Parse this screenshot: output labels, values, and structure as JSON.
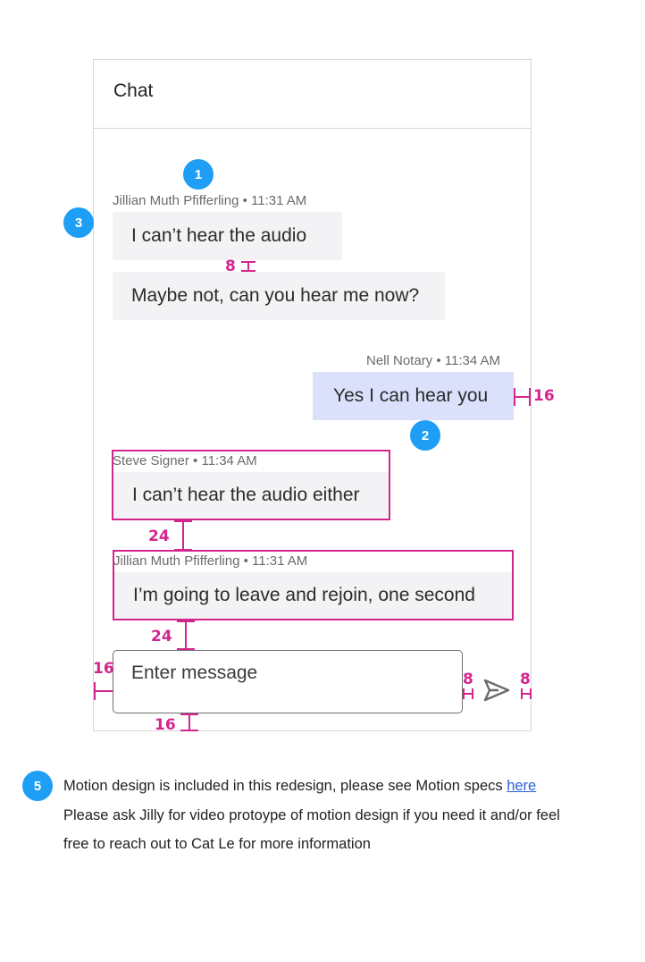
{
  "panel": {
    "title": "Chat"
  },
  "messages": [
    {
      "meta": "Jillian Muth Pfifferling • 11:31 AM",
      "text": "I can’t hear the audio"
    },
    {
      "text": "Maybe not, can you hear me now?"
    },
    {
      "meta": "Nell Notary • 11:34 AM",
      "text": "Yes I can hear you"
    },
    {
      "meta": "Steve Signer • 11:34 AM",
      "text": "I can’t hear the audio either"
    },
    {
      "meta": "Jillian Muth Pfifferling • 11:31 AM",
      "text": "I’m going to leave and rejoin, one second"
    }
  ],
  "input": {
    "placeholder": "Enter message"
  },
  "badges": [
    "1",
    "2",
    "3",
    "5"
  ],
  "spacing_labels": {
    "bubble_gap": "8",
    "bubble_right": "16",
    "group_gap_1": "24",
    "group_gap_2": "24",
    "input_left": "16",
    "input_bottom": "16",
    "send_left": "8",
    "send_right": "8"
  },
  "notes": {
    "line1_prefix": "Motion design is included in this redesign, please see Motion specs ",
    "line1_link": "here",
    "line2": "Please ask Jilly for video protoype of motion design if you need it and/or feel",
    "line3": "free to reach out to Cat Le for more information"
  },
  "colors": {
    "badge": "#1e9ef5",
    "redline": "#d4258f",
    "bubble_received": "#f3f3f5",
    "bubble_sent": "#dce1fb",
    "link": "#2b5fd9"
  },
  "icons": {
    "send": "send-icon"
  }
}
